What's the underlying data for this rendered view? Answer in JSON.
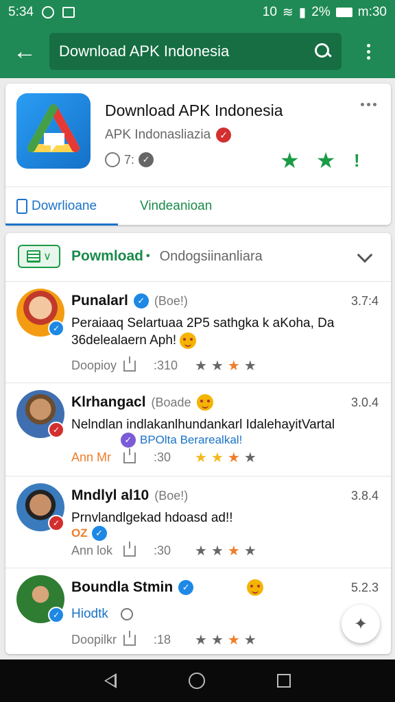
{
  "status_bar": {
    "time": "5:34",
    "right_text": "10",
    "battery_text": "2%",
    "clock_text": "m:30"
  },
  "toolbar": {
    "back_icon": "arrow-back-icon",
    "search_text": "Download APK Indonesia",
    "search_icon": "search-icon",
    "more_icon": "more-vert-icon"
  },
  "app": {
    "title": "Download APK Indonesia",
    "developer": "APK Indonasliazia",
    "meta_count": "7:",
    "tabs": [
      "Dowrlioane",
      "Vindeanioan"
    ]
  },
  "feed": {
    "title": "Powmload",
    "dot": "•",
    "subtitle": "Ondogsiinanliara",
    "reviews": [
      {
        "name": "Punalarl",
        "tag": "(Boe!)",
        "version": "3.7:4",
        "text": "Peraiaaq Selartuaa 2P5 sathgka k aKoha, Da 36delealaern Aph!",
        "by": "Doopioy",
        "count": ":310",
        "stars": [
          "grey",
          "grey",
          "orange",
          "grey"
        ],
        "extra": ""
      },
      {
        "name": "Klrhangacl",
        "tag": "(Boade",
        "version": "3.0.4",
        "text": "Nelndlan indlakanlhundankarl IdalehayitVartal",
        "extra": "BPOlta Berarealkal!",
        "by": "Ann Mr",
        "count": ":30",
        "stars": [
          "gold",
          "gold",
          "orange",
          "grey"
        ]
      },
      {
        "name": "Mndlyl al10",
        "tag": "(Boe!)",
        "version": "3.8.4",
        "text": "Prnvlandlgekad hdoasd ad!!",
        "extra": "OZ",
        "by": "Ann lok",
        "count": ":30",
        "stars": [
          "grey",
          "grey",
          "orange",
          "grey"
        ]
      },
      {
        "name": "Boundla Stmin",
        "tag": "",
        "version": "5.2.3",
        "text": "",
        "extra": "Hiodtk",
        "by": "Doopilkr",
        "count": ":18",
        "stars": [
          "grey",
          "grey",
          "orange",
          "grey"
        ]
      }
    ]
  },
  "colors": {
    "primary": "#1f8a55",
    "accent_blue": "#1a73c8",
    "star_orange": "#ef7d2a"
  }
}
